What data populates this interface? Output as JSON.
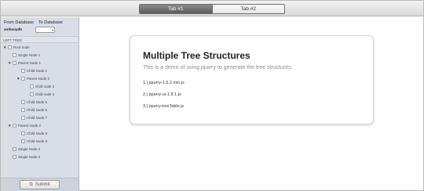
{
  "tabs": [
    {
      "label": "Tab #1",
      "active": true
    },
    {
      "label": "Tab #2",
      "active": false
    }
  ],
  "sidebar": {
    "from_db_label": "From Database",
    "to_db_label": "To Database",
    "user": "anthonydb",
    "tree_header": "LEFT TREE",
    "nodes": [
      {
        "label": "Root node",
        "expanded": true
      },
      {
        "label": "Single Node 1"
      },
      {
        "label": "Parent Node 1",
        "expanded": true
      },
      {
        "label": "Child Node 1"
      },
      {
        "label": "Parent Node 2",
        "expanded": true
      },
      {
        "label": "child node 3"
      },
      {
        "label": "child node 4"
      },
      {
        "label": "Child Node 5"
      },
      {
        "label": "Child Node 6"
      },
      {
        "label": "Child Node 7"
      },
      {
        "label": "Parent Node 2",
        "expanded": true
      },
      {
        "label": "Child Node 8"
      },
      {
        "label": "Child Node 9"
      },
      {
        "label": "Single Node 2"
      },
      {
        "label": "Single Node 3"
      }
    ],
    "submit_label": "Submit"
  },
  "main": {
    "title": "Multiple Tree Structures",
    "subtitle": "This is a demo of using jquery to generate the tree structures.",
    "items": [
      "1.) jquery-1.6.2.min.js",
      "2.) jquery-ui-1.8.1.js",
      "3.) jquery.treeTable.js"
    ]
  },
  "colors": {
    "sidebar_bg": "#d8dde6",
    "tab_active_bg": "#6e6e6e",
    "card_border": "#d4d4d4"
  }
}
